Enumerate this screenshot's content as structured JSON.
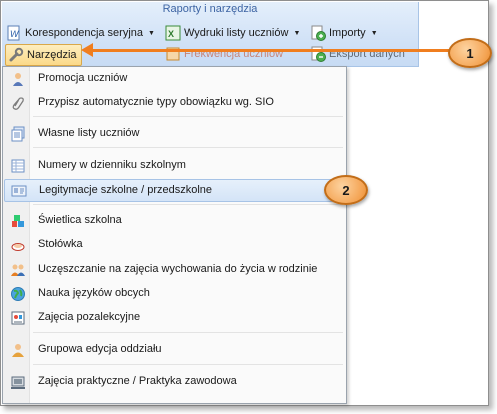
{
  "ribbon": {
    "title": "Raporty i narzędzia",
    "buttons": {
      "korespondencja": "Korespondencja seryjna",
      "wydruki": "Wydruki listy uczniów",
      "importy": "Importy",
      "narzedzia": "Narzędzia",
      "frekwencja": "Frekwencja uczniów",
      "eksport": "Eksport danych"
    }
  },
  "menu": {
    "items": [
      {
        "label": "Promocja uczniów",
        "icon": "promotion-icon"
      },
      {
        "label": "Przypisz automatycznie typy obowiązku wg. SIO",
        "icon": "paperclip-icon"
      },
      {
        "label": "Własne listy uczniów",
        "icon": "custom-lists-icon"
      },
      {
        "label": "Numery w dzienniku szkolnym",
        "icon": "journal-numbers-icon"
      },
      {
        "label": "Legitymacje szkolne / przedszkolne",
        "icon": "id-card-icon"
      },
      {
        "label": "Świetlica szkolna",
        "icon": "common-room-icon"
      },
      {
        "label": "Stołówka",
        "icon": "canteen-icon"
      },
      {
        "label": "Uczęszczanie na zajęcia wychowania do życia w rodzinie",
        "icon": "family-education-icon"
      },
      {
        "label": "Nauka języków obcych",
        "icon": "globe-icon"
      },
      {
        "label": "Zajęcia pozalekcyjne",
        "icon": "extracurricular-icon"
      },
      {
        "label": "Grupowa edycja oddziału",
        "icon": "group-edit-icon"
      },
      {
        "label": "Zajęcia praktyczne / Praktyka zawodowa",
        "icon": "practical-classes-icon"
      }
    ]
  },
  "callouts": {
    "one": "1",
    "two": "2"
  },
  "colors": {
    "accent": "#f07e1f",
    "ribbon_title": "#3d64a3",
    "highlight": "#d4e4f7"
  }
}
